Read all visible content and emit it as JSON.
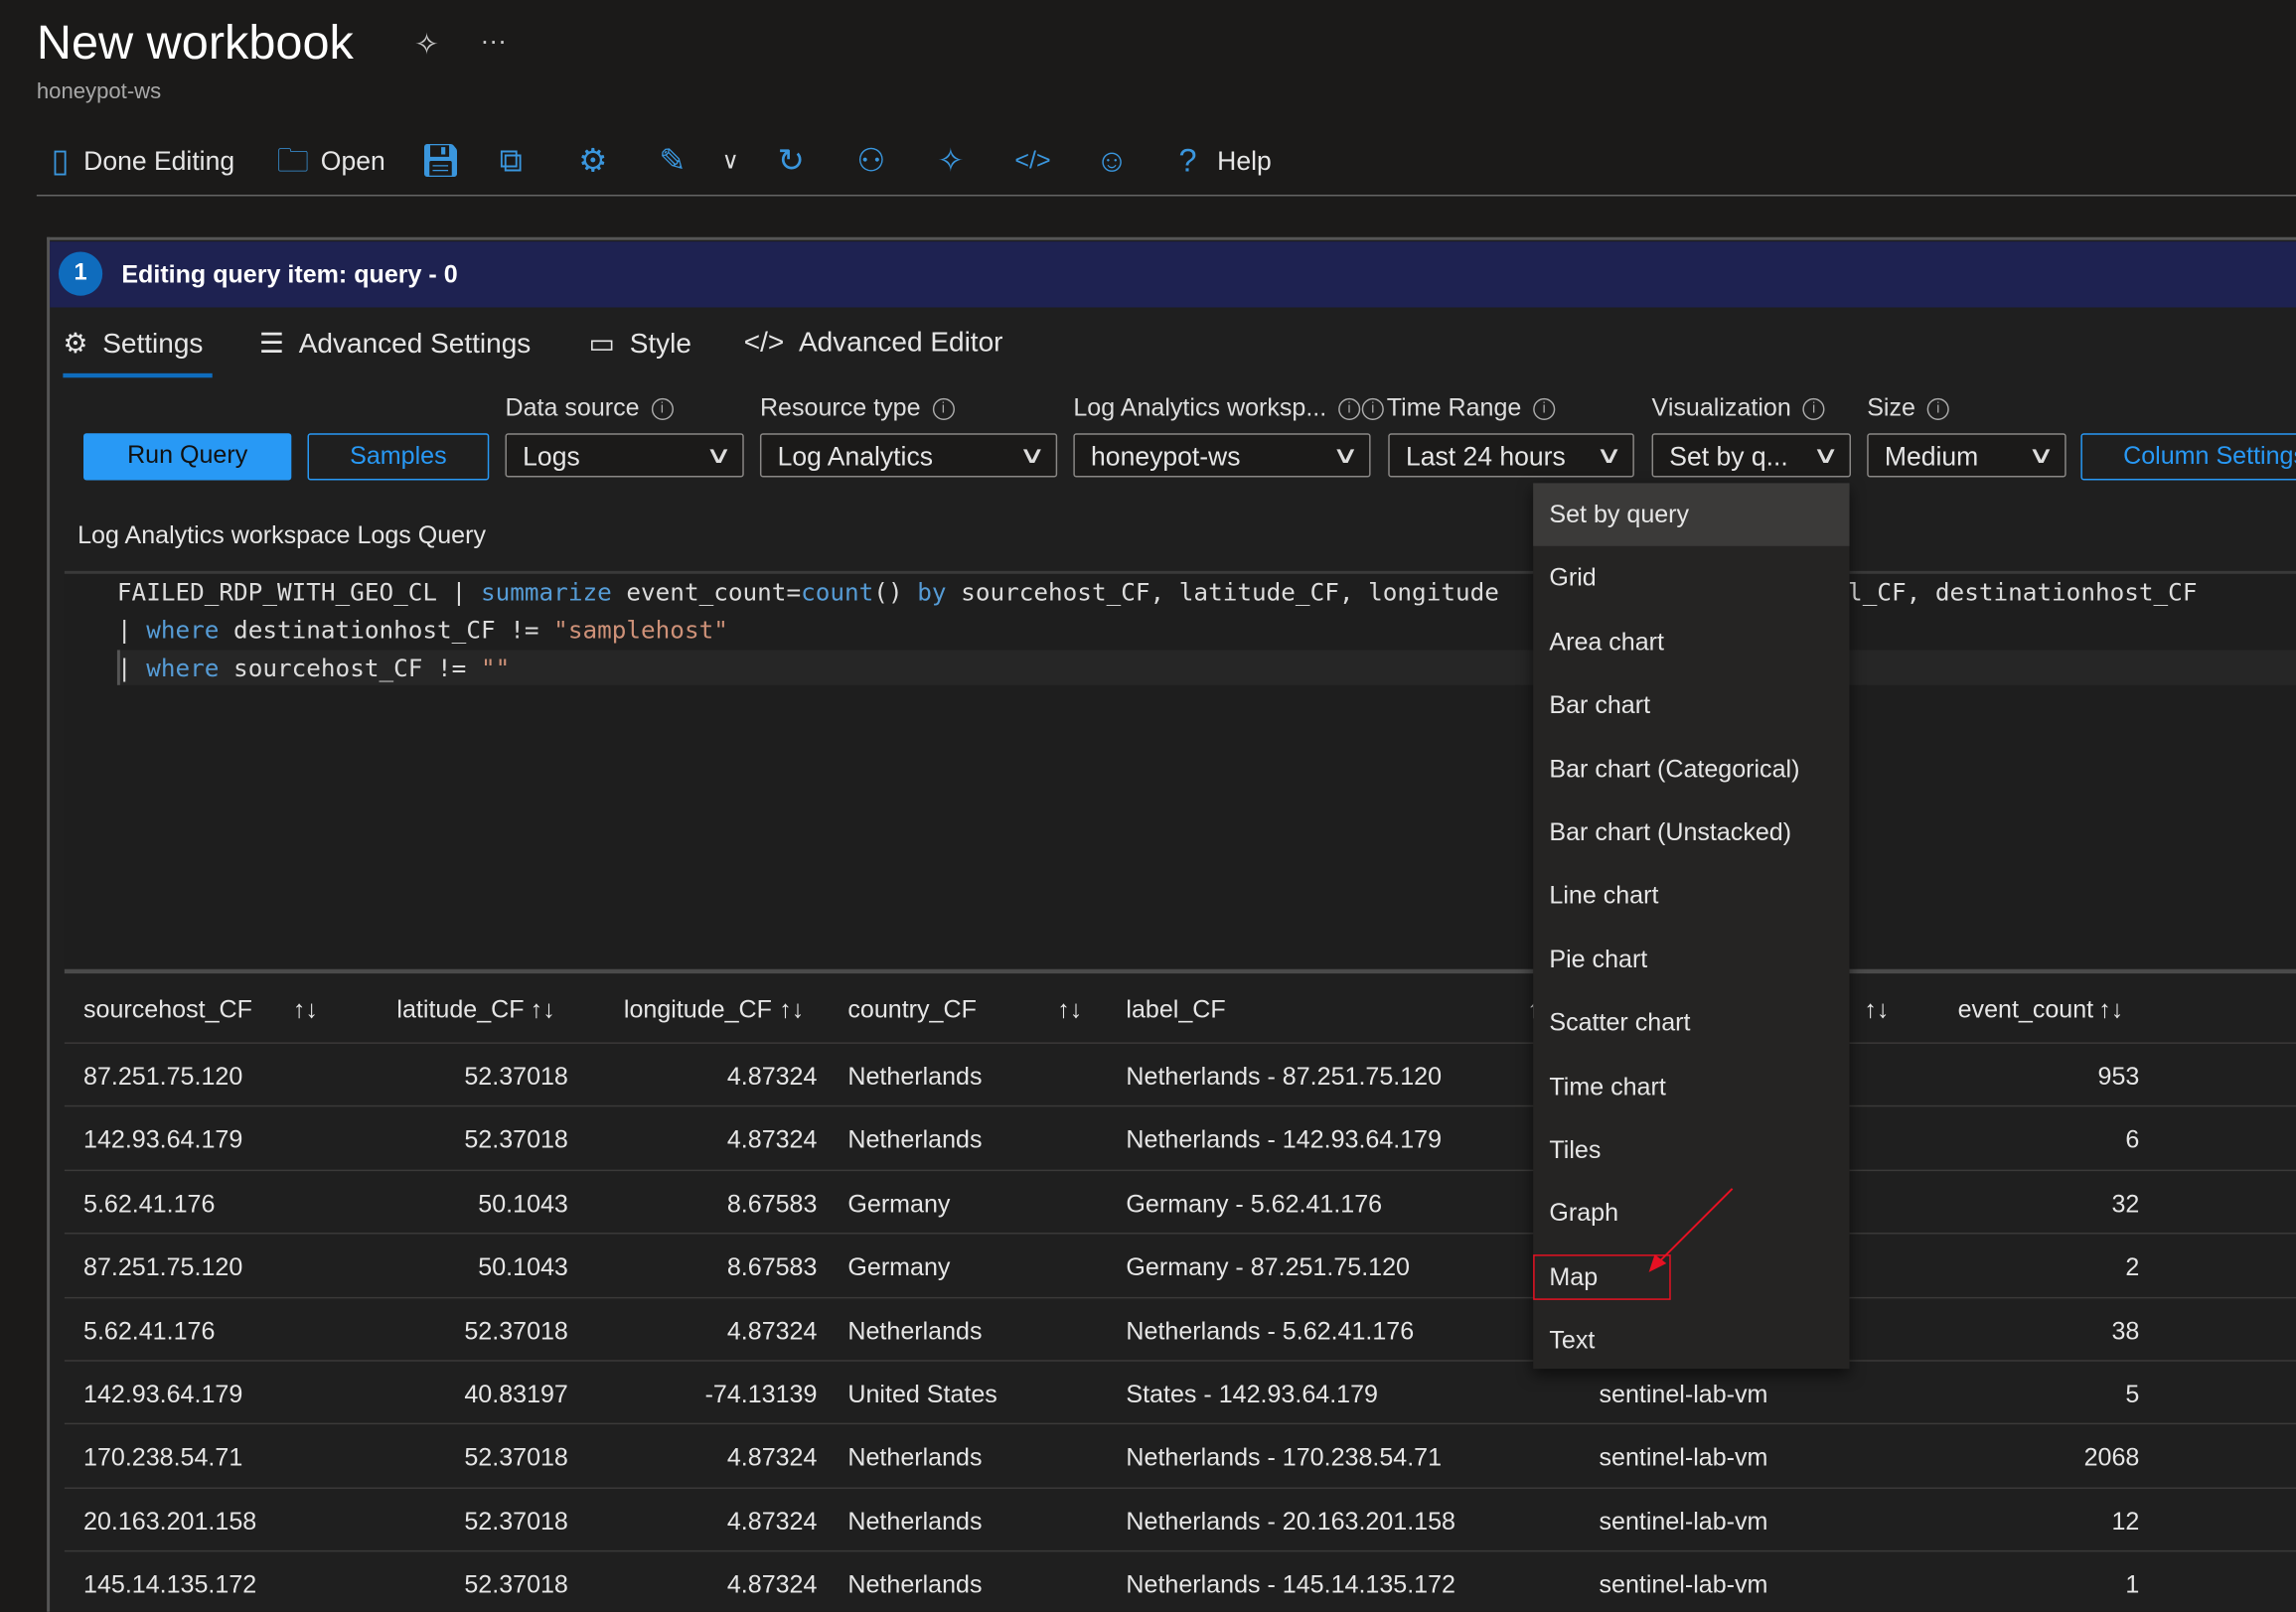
{
  "header": {
    "title": "New workbook",
    "subtitle": "honeypot-ws"
  },
  "toolbar": {
    "done_editing": "Done Editing",
    "open": "Open",
    "help": "Help"
  },
  "item_header": {
    "number": "1",
    "title": "Editing query item: query - 0"
  },
  "tabs": [
    {
      "label": "Settings",
      "active": true
    },
    {
      "label": "Advanced Settings"
    },
    {
      "label": "Style"
    },
    {
      "label": "Advanced Editor"
    }
  ],
  "controls": {
    "run_query": "Run Query",
    "samples": "Samples",
    "column_settings": "Column Settings",
    "data_source": {
      "label": "Data source",
      "value": "Logs"
    },
    "resource_type": {
      "label": "Resource type",
      "value": "Log Analytics"
    },
    "workspace": {
      "label": "Log Analytics worksp...",
      "value": "honeypot-ws"
    },
    "time_range": {
      "label": "Time Range",
      "value": "Last 24 hours"
    },
    "visualization": {
      "label": "Visualization",
      "value": "Set by q..."
    },
    "size": {
      "label": "Size",
      "value": "Medium"
    }
  },
  "query": {
    "label": "Log Analytics workspace Logs Query",
    "l1a": "FAILED_RDP_WITH_GEO_CL | ",
    "l1kw": "summarize",
    "l1b": " event_count=",
    "l1fn": "count",
    "l1c": "() ",
    "l1by": "by",
    "l1d": " sourcehost_CF, latitude_CF, longitude",
    "l1e": "l_CF, destinationhost_CF",
    "l2a": "| ",
    "l2kw": "where",
    "l2b": " destinationhost_CF != ",
    "l2s": "\"samplehost\"",
    "l3a": "| ",
    "l3kw": "where",
    "l3b": " sourcehost_CF != ",
    "l3s": "\"\""
  },
  "table": {
    "headers": [
      "sourcehost_CF",
      "latitude_CF",
      "longitude_CF",
      "country_CF",
      "label_CF",
      "",
      "event_count"
    ],
    "sort_icon": "↑↓",
    "rows": [
      [
        "87.251.75.120",
        "52.37018",
        "4.87324",
        "Netherlands",
        "Netherlands - 87.251.75.120",
        "",
        "953"
      ],
      [
        "142.93.64.179",
        "52.37018",
        "4.87324",
        "Netherlands",
        "Netherlands - 142.93.64.179",
        "",
        "6"
      ],
      [
        "5.62.41.176",
        "50.1043",
        "8.67583",
        "Germany",
        "Germany - 5.62.41.176",
        "",
        "32"
      ],
      [
        "87.251.75.120",
        "50.1043",
        "8.67583",
        "Germany",
        "Germany - 87.251.75.120",
        "",
        "2"
      ],
      [
        "5.62.41.176",
        "52.37018",
        "4.87324",
        "Netherlands",
        "Netherlands - 5.62.41.176",
        "",
        "38"
      ],
      [
        "142.93.64.179",
        "40.83197",
        "-74.13139",
        "United States",
        "States - 142.93.64.179",
        "sentinel-lab-vm",
        "5"
      ],
      [
        "170.238.54.71",
        "52.37018",
        "4.87324",
        "Netherlands",
        "Netherlands - 170.238.54.71",
        "sentinel-lab-vm",
        "2068"
      ],
      [
        "20.163.201.158",
        "52.37018",
        "4.87324",
        "Netherlands",
        "Netherlands - 20.163.201.158",
        "sentinel-lab-vm",
        "12"
      ],
      [
        "145.14.135.172",
        "52.37018",
        "4.87324",
        "Netherlands",
        "Netherlands - 145.14.135.172",
        "sentinel-lab-vm",
        "1"
      ]
    ]
  },
  "visualization_menu": {
    "selected": "Set by query",
    "highlighted": "Map",
    "items": [
      "Set by query",
      "Grid",
      "Area chart",
      "Bar chart",
      "Bar chart (Categorical)",
      "Bar chart (Unstacked)",
      "Line chart",
      "Pie chart",
      "Scatter chart",
      "Time chart",
      "Tiles",
      "Graph",
      "Map",
      "Text"
    ]
  },
  "colors": {
    "accent": "#3a96dd",
    "header_bar": "#1e2251",
    "highlight_box": "#e81123"
  }
}
